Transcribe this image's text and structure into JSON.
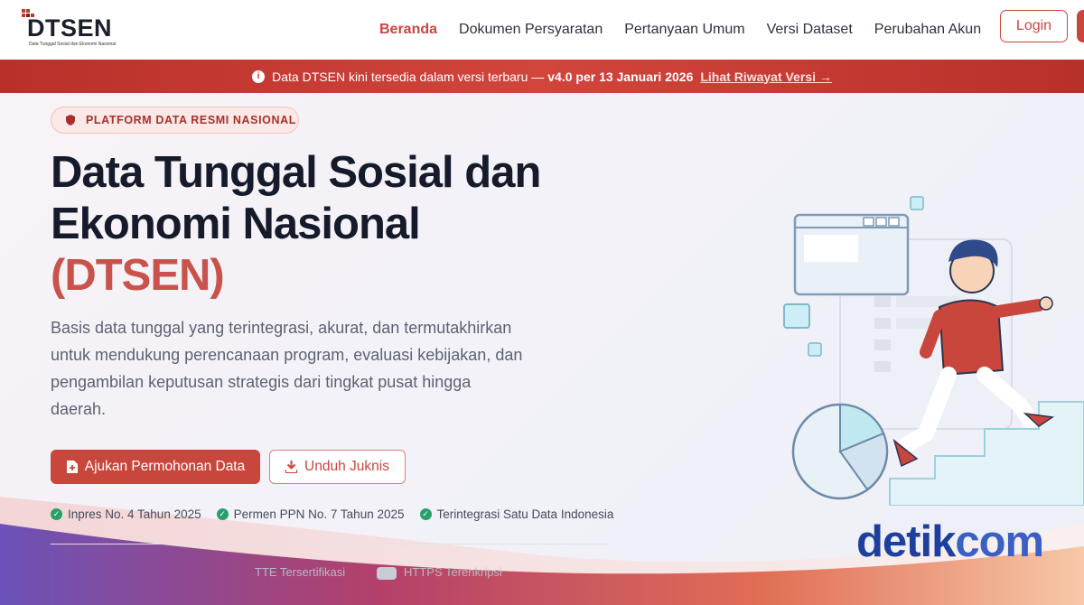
{
  "header": {
    "logo_text": "DTSEN",
    "logo_subtitle": "Data Tunggal Sosial dan Ekonomi Nasional",
    "nav": [
      {
        "label": "Beranda",
        "active": true
      },
      {
        "label": "Dokumen Persyaratan",
        "active": false
      },
      {
        "label": "Pertanyaan Umum",
        "active": false
      },
      {
        "label": "Versi Dataset",
        "active": false
      },
      {
        "label": "Perubahan Akun",
        "active": false
      }
    ],
    "login_label": "Login"
  },
  "announcement": {
    "text": "Data DTSEN kini tersedia dalam versi terbaru —",
    "version": "v4.0 per 13 Januari 2026",
    "link": "Lihat Riwayat Versi →"
  },
  "hero": {
    "badge": "PLATFORM DATA RESMI NASIONAL",
    "title_line1": "Data Tunggal Sosial dan",
    "title_line2": "Ekonomi Nasional",
    "title_accent": "(DTSEN)",
    "description": "Basis data tunggal yang terintegrasi, akurat, dan termutakhirkan untuk mendukung perencanaan program, evaluasi kebijakan, dan pengambilan keputusan strategis dari tingkat pusat hingga daerah.",
    "primary_button": "Ajukan Permohonan Data",
    "secondary_button": "Unduh Juknis",
    "checks": [
      "Inpres No. 4 Tahun 2025",
      "Permen PPN No. 7 Tahun 2025",
      "Terintegrasi Satu Data Indonesia"
    ],
    "footer_items": [
      "TTE Tersertifikasi",
      "HTTPS Terenkripsi"
    ]
  },
  "watermark": {
    "part1": "detik",
    "part2": "com"
  },
  "colors": {
    "brand": "#c9463d",
    "check": "#27a06b",
    "watermark": "#1d3f9e"
  }
}
